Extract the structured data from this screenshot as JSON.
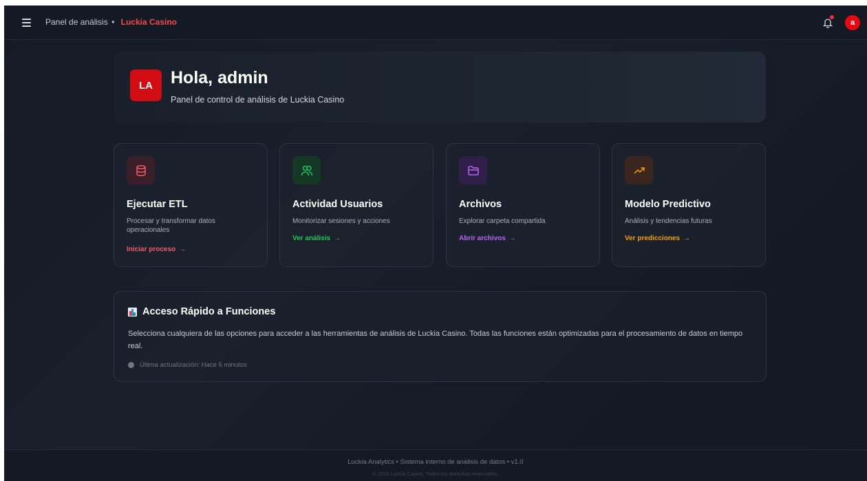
{
  "header": {
    "crumb_label": "Panel de análisis",
    "separator": "•",
    "brand": "Luckia Casino",
    "avatar_letter": "a"
  },
  "hero": {
    "logo_text": "LA",
    "title": "Hola, admin",
    "subtitle": "Panel de control de análisis de Luckia Casino"
  },
  "cards": [
    {
      "title": "Ejecutar ETL",
      "description": "Procesar y transformar datos operacionales",
      "action": "Iniciar proceso",
      "icon": "database-icon",
      "accent": "#f05a66",
      "icon_bg": "#3a1e28"
    },
    {
      "title": "Actividad Usuarios",
      "description": "Monitorizar sesiones y acciones",
      "action": "Ver análisis",
      "icon": "users-icon",
      "accent": "#22c55e",
      "icon_bg": "#153726"
    },
    {
      "title": "Archivos",
      "description": "Explorar carpeta compartida",
      "action": "Abrir archivos",
      "icon": "folder-icon",
      "accent": "#b565f5",
      "icon_bg": "#2f1f4a"
    },
    {
      "title": "Modelo Predictivo",
      "description": "Análisis y tendencias futuras",
      "action": "Ver predicciones",
      "icon": "trending-up-icon",
      "accent": "#f59e0b",
      "icon_bg": "#3a261e"
    }
  ],
  "quick_access": {
    "title": "Acceso Rápido a Funciones",
    "description": "Selecciona cualquiera de las opciones para acceder a las herramientas de análisis de Luckia Casino. Todas las funciones están optimizadas para el procesamiento de datos en tiempo real.",
    "updated": "Última actualización: Hace 5 minutos"
  },
  "footer": {
    "line1": "Luckia Analytics • Sistema interno de análisis de datos • v1.0",
    "line2": "© 2025 Luckia Casino. Todos los derechos reservados."
  },
  "colors": {
    "brand_red": "#e50914",
    "background": "#161c26"
  }
}
